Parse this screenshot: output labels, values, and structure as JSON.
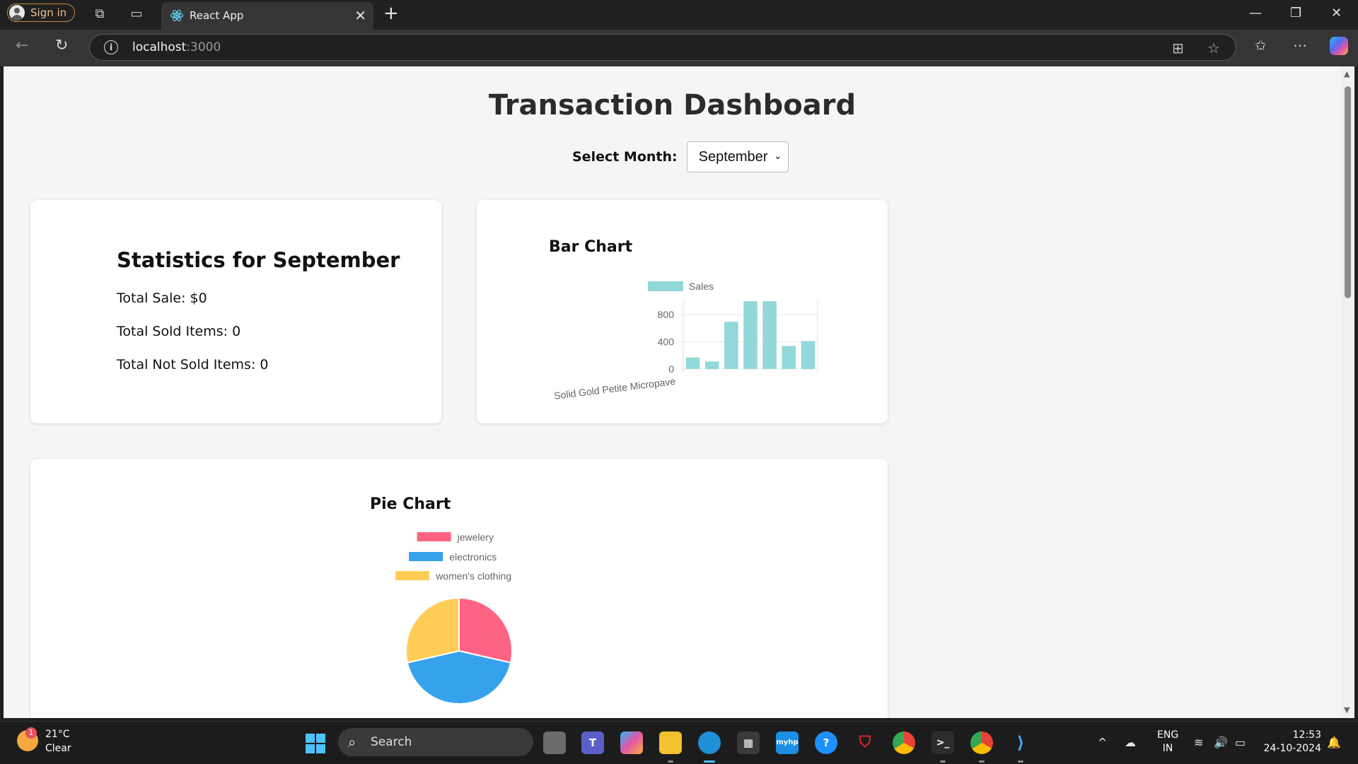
{
  "browser": {
    "sign_in_label": "Sign in",
    "tab_title": "React App",
    "address_host": "localhost",
    "address_port": ":3000"
  },
  "page": {
    "title": "Transaction Dashboard",
    "month_label": "Select Month:",
    "month_selected": "September"
  },
  "stats": {
    "heading": "Statistics for September",
    "total_sale": "Total Sale: $0",
    "total_sold": "Total Sold Items: 0",
    "total_not_sold": "Total Not Sold Items: 0"
  },
  "bar_chart": {
    "heading": "Bar Chart"
  },
  "pie_chart": {
    "heading": "Pie Chart"
  },
  "chart_data": [
    {
      "type": "bar",
      "title": "Bar Chart",
      "series": [
        {
          "name": "Sales",
          "values": [
            168,
            110,
            695,
            999,
            999,
            340,
            410
          ],
          "color": "#93d8d8"
        }
      ],
      "categories": [
        "Solid Gold Petite Micropave",
        "",
        "",
        "",
        "",
        "",
        ""
      ],
      "yticks": [
        0,
        400,
        800
      ],
      "ylim": [
        0,
        1000
      ],
      "legend": "top"
    },
    {
      "type": "pie",
      "title": "Pie Chart",
      "labels": [
        "jewelery",
        "electronics",
        "women's clothing"
      ],
      "values": [
        4,
        6,
        4
      ],
      "colors": [
        "#ff6384",
        "#36a2eb",
        "#ffcd56"
      ],
      "legend": "top"
    }
  ],
  "taskbar": {
    "weather_temp": "21°C",
    "weather_cond": "Clear",
    "weather_badge": "1",
    "search_label": "Search",
    "lang_1": "ENG",
    "lang_2": "IN",
    "time": "12:53",
    "date": "24-10-2024"
  }
}
